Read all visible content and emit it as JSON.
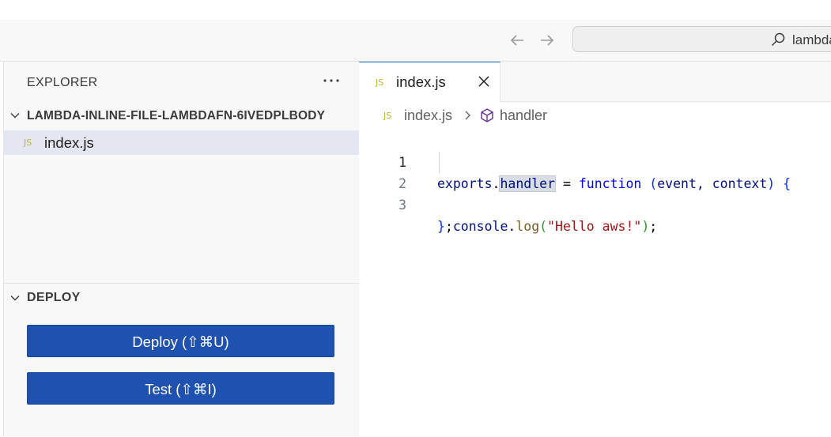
{
  "title_bar": {
    "search_text": "lambda",
    "colors": {
      "background": "#f8f8f8",
      "accent": "#1f52b0"
    }
  },
  "sidebar": {
    "explorer_title": "EXPLORER",
    "folder_name": "LAMBDA-INLINE-FILE-LAMBDAFN-6IVEDPLBODY",
    "files": [
      {
        "badge": "JS",
        "name": "index.js",
        "selected": true
      }
    ],
    "deploy": {
      "title": "DEPLOY",
      "deploy_button": "Deploy (⇧⌘U)",
      "test_button": "Test (⇧⌘I)"
    }
  },
  "editor": {
    "tab": {
      "badge": "JS",
      "label": "index.js"
    },
    "breadcrumb": {
      "badge": "JS",
      "file": "index.js",
      "symbol": "handler"
    },
    "line_numbers": [
      "1",
      "2",
      "3"
    ],
    "code": {
      "l1": {
        "exports": "exports",
        "dot": ".",
        "handler": "handler",
        "eq": " = ",
        "function": "function",
        "sp": " ",
        "paren_open": "(",
        "params": "event, context",
        "paren_close": ")",
        "brace": " {"
      },
      "l2": {
        "indent": "  ",
        "console": "console",
        "dot": ".",
        "log": "log",
        "paren_open": "(",
        "string": "\"Hello aws!\"",
        "paren_close": ")",
        "semi": ";"
      },
      "l3": {
        "brace": "}",
        "semi": ";"
      }
    }
  }
}
